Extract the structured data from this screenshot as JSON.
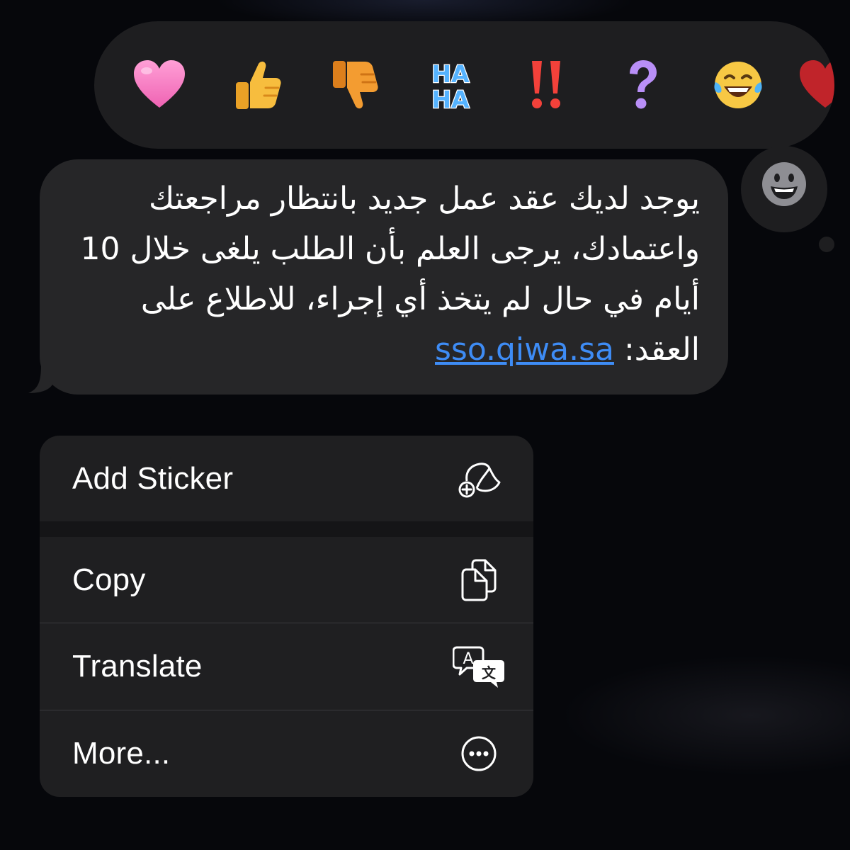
{
  "reactions": [
    {
      "name": "heart",
      "icon": "heart-icon",
      "color": "#f47fc3"
    },
    {
      "name": "thumbs-up",
      "icon": "thumbs-up-icon",
      "color": "#f5b83a"
    },
    {
      "name": "thumbs-down",
      "icon": "thumbs-down-icon",
      "color": "#f0932a"
    },
    {
      "name": "haha",
      "icon": "haha-icon",
      "color": "#4aa9f5",
      "text_top": "HA",
      "text_bottom": "HA"
    },
    {
      "name": "exclamation",
      "icon": "double-exclamation-icon",
      "color": "#f0413a"
    },
    {
      "name": "question",
      "icon": "question-icon",
      "color": "#b58cf5"
    },
    {
      "name": "laughing",
      "icon": "tears-of-joy-icon",
      "color": "#f6c445"
    },
    {
      "name": "more-emoji",
      "icon": "partial-emoji-icon",
      "color": "#c8242c"
    }
  ],
  "add_reaction": {
    "icon": "smiley-add-icon"
  },
  "message": {
    "text": "يوجد لديك عقد عمل جديد بانتظار مراجعتك واعتمادك، يرجى العلم بأن الطلب يلغى خلال 10 أيام في حال لم يتخذ أي إجراء، للاطلاع على العقد: ",
    "link": "sso.qiwa.sa"
  },
  "menu": {
    "add_sticker": {
      "label": "Add Sticker",
      "icon": "sticker-add-icon"
    },
    "copy": {
      "label": "Copy",
      "icon": "copy-icon"
    },
    "translate": {
      "label": "Translate",
      "icon": "translate-icon"
    },
    "more": {
      "label": "More...",
      "icon": "ellipsis-circle-icon"
    }
  },
  "colors": {
    "background": "#06070b",
    "bubble": "#262628",
    "menu": "#1f1f21",
    "link": "#3e8cf5",
    "text": "#ffffff"
  }
}
